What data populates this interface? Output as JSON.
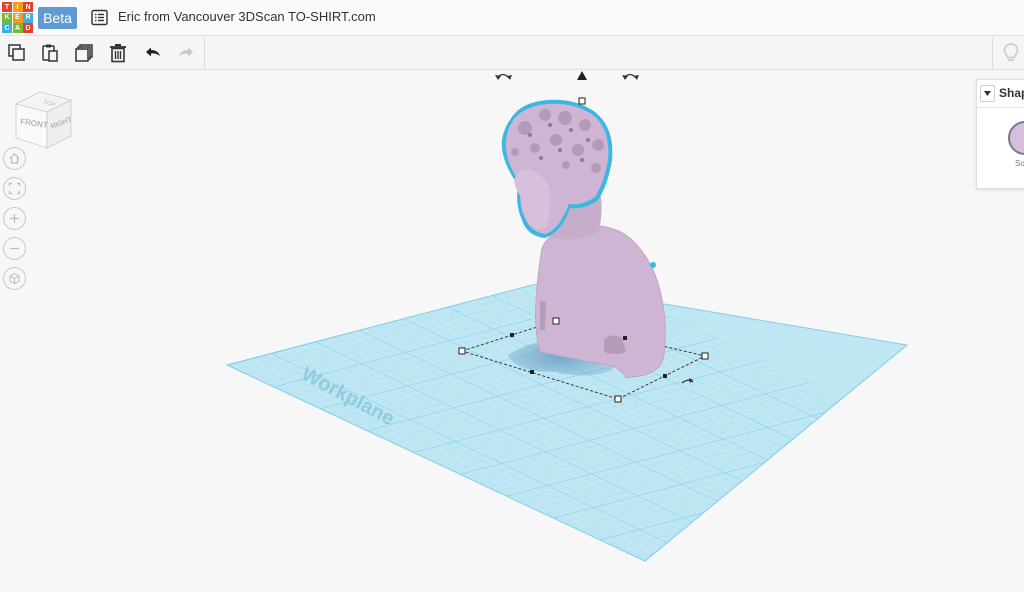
{
  "app": {
    "logo_letters": [
      "T",
      "I",
      "N",
      "K",
      "E",
      "R",
      "C",
      "A",
      "D"
    ],
    "logo_colors": [
      "#e2412b",
      "#f39c1b",
      "#e2412b",
      "#79b935",
      "#f39c1b",
      "#3daee3",
      "#3daee3",
      "#79b935",
      "#e2412b"
    ],
    "beta_label": "Beta",
    "design_title": "Eric from Vancouver 3DScan TO-SHIRT.com"
  },
  "toolbar": {
    "buttons": [
      {
        "name": "copy-icon"
      },
      {
        "name": "paste-icon"
      },
      {
        "name": "duplicate-icon"
      },
      {
        "name": "delete-icon"
      },
      {
        "name": "undo-icon"
      },
      {
        "name": "redo-icon"
      },
      {
        "name": "lightbulb-icon"
      }
    ]
  },
  "view_cube": {
    "front_label": "FRONT",
    "right_label": "RIGHT",
    "top_label": "TOP"
  },
  "view_controls": [
    "home-icon",
    "fit-view-icon",
    "zoom-in-icon",
    "zoom-out-icon",
    "perspective-icon"
  ],
  "workplane": {
    "label": "Workplane",
    "color": "#7fcde6"
  },
  "model": {
    "color": "#cdb5d3",
    "outline_color": "#3ab7e2"
  },
  "shape_panel": {
    "title": "Shape",
    "swatch_label": "Solid"
  }
}
